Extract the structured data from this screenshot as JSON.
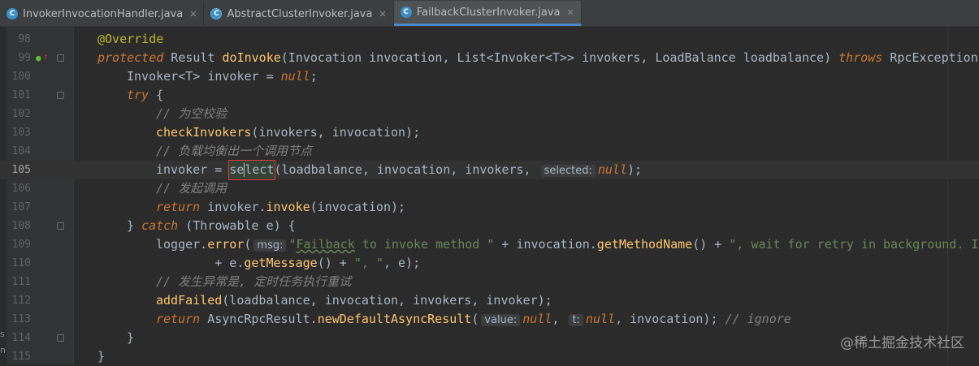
{
  "tabs": [
    {
      "label": "InvokerInvocationHandler.java",
      "icon": "class-icon",
      "active": false
    },
    {
      "label": "AbstractClusterInvoker.java",
      "icon": "abstract-class-icon",
      "active": false
    },
    {
      "label": "FailbackClusterInvoker.java",
      "icon": "class-icon",
      "active": true
    }
  ],
  "line_numbers": [
    "98",
    "99",
    "100",
    "101",
    "102",
    "103",
    "104",
    "105",
    "106",
    "107",
    "108",
    "109",
    "110",
    "111",
    "112",
    "113",
    "114",
    "115"
  ],
  "code": {
    "l98_annotation": "@Override",
    "l99_protected": "protected",
    "l99_result": " Result ",
    "l99_method": "doInvoke",
    "l99_params_a": "(Invocation ",
    "l99_p1": "invocation",
    "l99_params_b": ", List<Invoker<T>> ",
    "l99_p2": "invokers",
    "l99_params_c": ", LoadBalance ",
    "l99_p3": "loadbalance",
    "l99_params_d": ") ",
    "l99_throws": "throws",
    "l99_exc": " RpcException",
    "l100_a": "Invoker<T> invoker = ",
    "l100_null": "null",
    "l100_b": ";",
    "l101_try": "try",
    "l101_b": " {",
    "l102_comment": "// 为空校验",
    "l103_call": "checkInvokers",
    "l103_args": "(invokers, invocation);",
    "l104_comment": "// 负载均衡出一个调用节点",
    "l105_a": "invoker = ",
    "l105_sel1": "se",
    "l105_sel2": "lect",
    "l105_args": "(loadbalance, invocation, invokers, ",
    "l105_hint": "selected:",
    "l105_null": "null",
    "l105_end": ");",
    "l106_comment": "// 发起调用",
    "l107_return": "return",
    "l107_a": " invoker.",
    "l107_invoke": "invoke",
    "l107_b": "(invocation);",
    "l108_a": "} ",
    "l108_catch": "catch",
    "l108_b": " (Throwable e) {",
    "l109_a": "logger.",
    "l109_error": "error",
    "l109_b": "(",
    "l109_hint": "msg:",
    "l109_str1": "\"",
    "l109_str_sq": "Failback",
    "l109_str2": " to invoke method \"",
    "l109_c": " + invocation.",
    "l109_get": "getMethodName",
    "l109_d": "() + ",
    "l109_str3": "\", wait for retry in background. I",
    "l110_a": "        + e.",
    "l110_get": "getMessage",
    "l110_b": "() + ",
    "l110_str": "\", \"",
    "l110_c": ", e);",
    "l111_comment": "// 发生异常是, 定时任务执行重试",
    "l112_call": "addFailed",
    "l112_args": "(loadbalance, invocation, invokers, invoker);",
    "l113_return": "return",
    "l113_a": " AsyncRpcResult.",
    "l113_call": "newDefaultAsyncResult",
    "l113_b": "(",
    "l113_hint1": "value:",
    "l113_null1": "null",
    "l113_c": ", ",
    "l113_hint2": "t:",
    "l113_null2": "null",
    "l113_d": ", invocation); ",
    "l113_comment": "// ignore",
    "l114": "}",
    "l115": "}"
  },
  "watermark": "@稀土掘金技术社区",
  "edge_letters": [
    "s",
    "n"
  ],
  "colors": {
    "background": "#2b2b2b",
    "keyword": "#cc7832",
    "method": "#ffc66d",
    "field": "#9876aa",
    "string": "#6a8759",
    "comment": "#808080",
    "annotation": "#bbb529",
    "highlight_box": "#e0393e"
  }
}
